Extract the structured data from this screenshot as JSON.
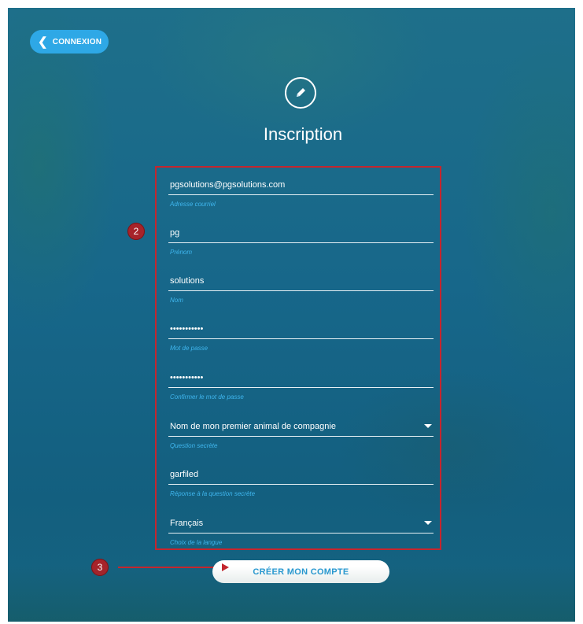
{
  "header": {
    "back_label": "CONNEXION",
    "title": "Inscription",
    "title_icon": "pencil-icon"
  },
  "form": {
    "fields": [
      {
        "value": "pgsolutions@pgsolutions.com",
        "label": "Adresse courriel"
      },
      {
        "value": "pg",
        "label": "Prénom"
      },
      {
        "value": "solutions",
        "label": "Nom"
      },
      {
        "value": "•••••••••••",
        "label": "Mot de passe"
      },
      {
        "value": "•••••••••••",
        "label": "Confirmer le mot de passe"
      },
      {
        "value": "Nom de mon premier animal de compagnie",
        "label": "Question secrète"
      },
      {
        "value": "garfiled",
        "label": "Réponse à la question secrète"
      },
      {
        "value": "Français",
        "label": "Choix de la langue"
      }
    ]
  },
  "actions": {
    "create_label": "CRÉER MON COMPTE"
  },
  "annotations": {
    "step_2": "2",
    "step_3": "3"
  },
  "colors": {
    "background": "#17678a",
    "accent": "#2ea8e6",
    "field_label": "#3fb6ee",
    "annotation": "#c4262e"
  }
}
